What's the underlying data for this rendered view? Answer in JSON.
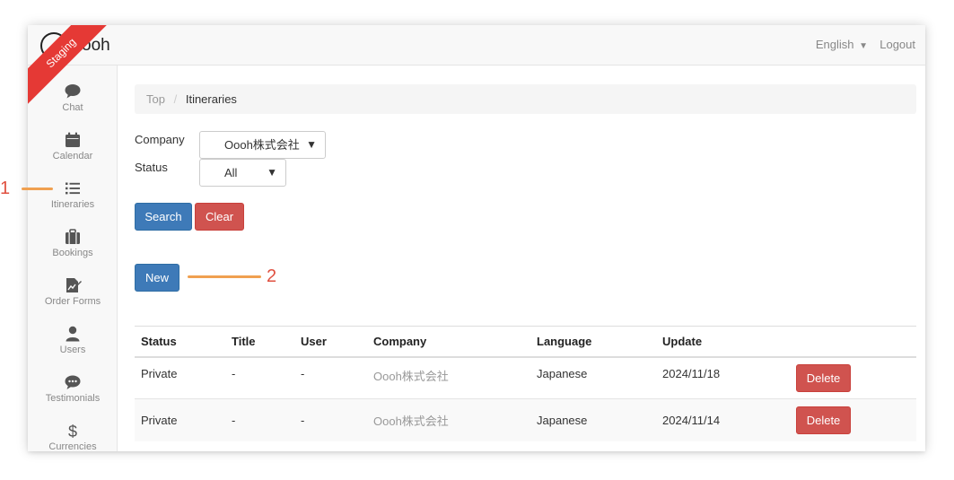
{
  "app": {
    "logo_text": "ooh",
    "staging_label": "Staging",
    "language": "English",
    "logout_label": "Logout"
  },
  "sidebar": {
    "items": [
      {
        "label": "Chat",
        "icon": "chat-bubble-icon"
      },
      {
        "label": "Calendar",
        "icon": "calendar-icon"
      },
      {
        "label": "Itineraries",
        "icon": "list-icon"
      },
      {
        "label": "Bookings",
        "icon": "suitcase-icon"
      },
      {
        "label": "Order Forms",
        "icon": "order-form-icon"
      },
      {
        "label": "Users",
        "icon": "user-icon"
      },
      {
        "label": "Testimonials",
        "icon": "comment-dots-icon"
      },
      {
        "label": "Currencies",
        "icon": "dollar-icon"
      }
    ]
  },
  "breadcrumb": {
    "top": "Top",
    "separator": "/",
    "current": "Itineraries"
  },
  "filters": {
    "company_label": "Company",
    "company_value": "Oooh株式会社",
    "status_label": "Status",
    "status_value": "All"
  },
  "buttons": {
    "search": "Search",
    "clear": "Clear",
    "new": "New"
  },
  "table": {
    "headers": {
      "status": "Status",
      "title": "Title",
      "user": "User",
      "company": "Company",
      "language": "Language",
      "update": "Update"
    },
    "rows": [
      {
        "status": "Private",
        "title": "-",
        "user": "-",
        "company": "Oooh株式会社",
        "language": "Japanese",
        "update": "2024/11/18",
        "action": "Delete"
      },
      {
        "status": "Private",
        "title": "-",
        "user": "-",
        "company": "Oooh株式会社",
        "language": "Japanese",
        "update": "2024/11/14",
        "action": "Delete"
      }
    ]
  },
  "annotations": {
    "one": "1",
    "two": "2"
  },
  "colors": {
    "primary": "#3e7ab8",
    "danger": "#d0534f",
    "ribbon": "#e53935",
    "annotation_line": "#f0a050",
    "annotation_number": "#e05040"
  }
}
